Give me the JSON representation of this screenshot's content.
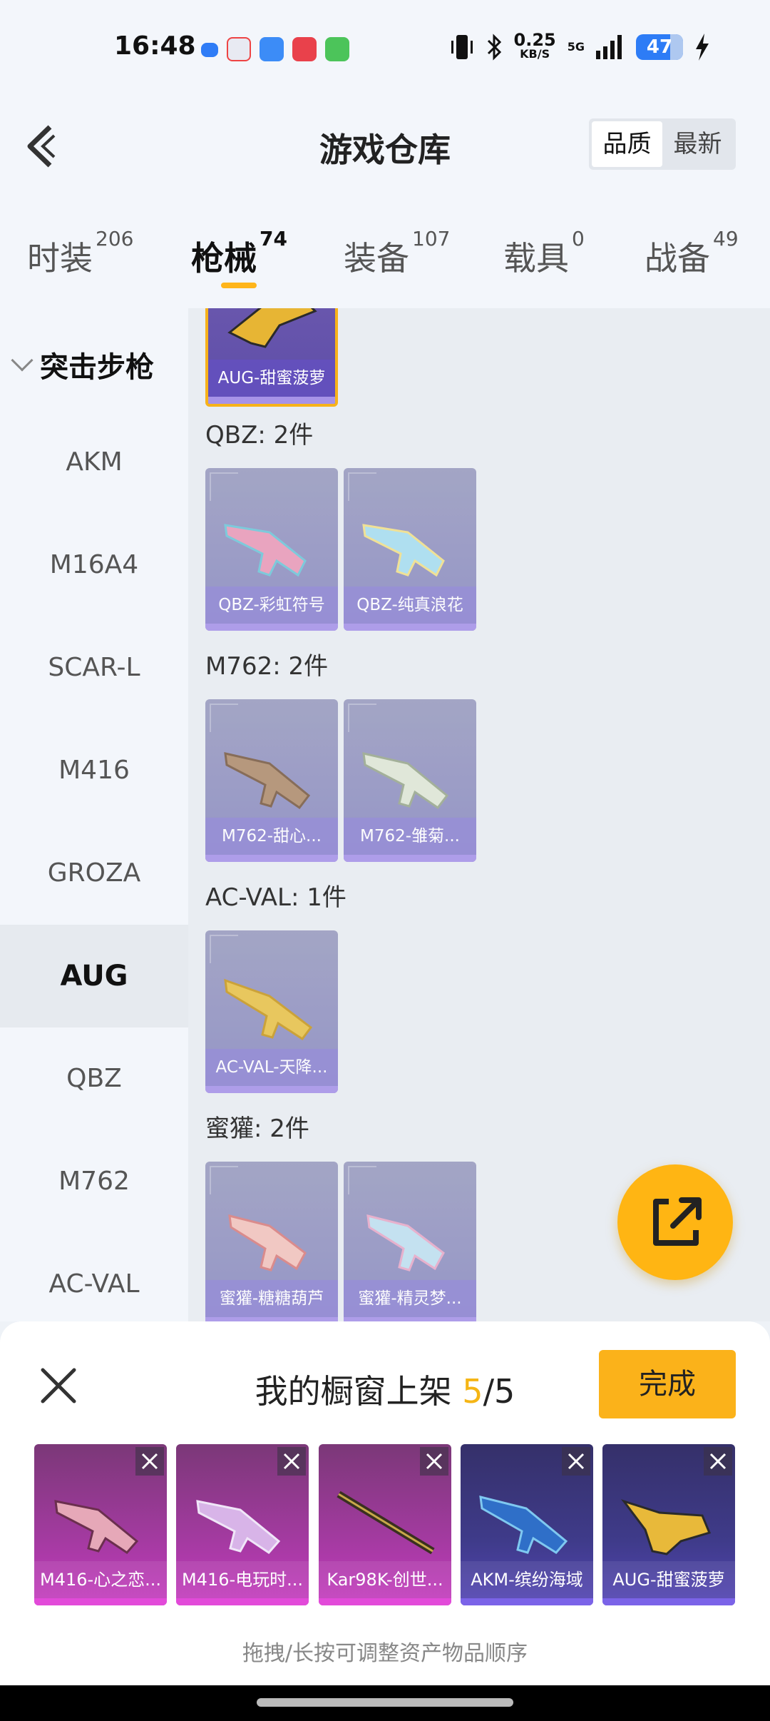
{
  "status": {
    "time": "16:48",
    "net_speed": "0.25",
    "net_unit": "KB/S",
    "network": "5G",
    "battery": "47"
  },
  "header": {
    "title": "游戏仓库",
    "sort_quality": "品质",
    "sort_newest": "最新"
  },
  "tabs": [
    {
      "label": "时装",
      "count": "206"
    },
    {
      "label": "枪械",
      "count": "74"
    },
    {
      "label": "装备",
      "count": "107"
    },
    {
      "label": "载具",
      "count": "0"
    },
    {
      "label": "战备",
      "count": "49"
    }
  ],
  "sidebar": {
    "group": "突击步枪",
    "items": [
      "AKM",
      "M16A4",
      "SCAR-L",
      "M416",
      "GROZA",
      "AUG",
      "QBZ",
      "M762",
      "AC-VAL"
    ],
    "active": "AUG"
  },
  "content": {
    "top_card": "AUG-甜蜜菠萝",
    "sections": [
      {
        "title": "QBZ: 2件",
        "items": [
          "QBZ-彩虹符号",
          "QBZ-纯真浪花"
        ]
      },
      {
        "title": "M762: 2件",
        "items": [
          "M762-甜心...",
          "M762-雏菊..."
        ]
      },
      {
        "title": "AC-VAL: 1件",
        "items": [
          "AC-VAL-天降..."
        ]
      },
      {
        "title": "蜜獾: 2件",
        "items": [
          "蜜獾-糖糖葫芦",
          "蜜獾-精灵梦..."
        ]
      }
    ]
  },
  "shelf": {
    "title": "我的橱窗上架",
    "count": "5",
    "total": "/5",
    "done_label": "完成",
    "hint": "拖拽/长按可调整资产物品顺序",
    "slots": [
      "M416-心之恋...",
      "M416-电玩时...",
      "Kar98K-创世...",
      "AKM-缤纷海域",
      "AUG-甜蜜菠萝"
    ]
  },
  "colors": {
    "accent": "#ffb51a",
    "shelf_pink": "#c53cbf",
    "shelf_blue": "#5344b4"
  }
}
